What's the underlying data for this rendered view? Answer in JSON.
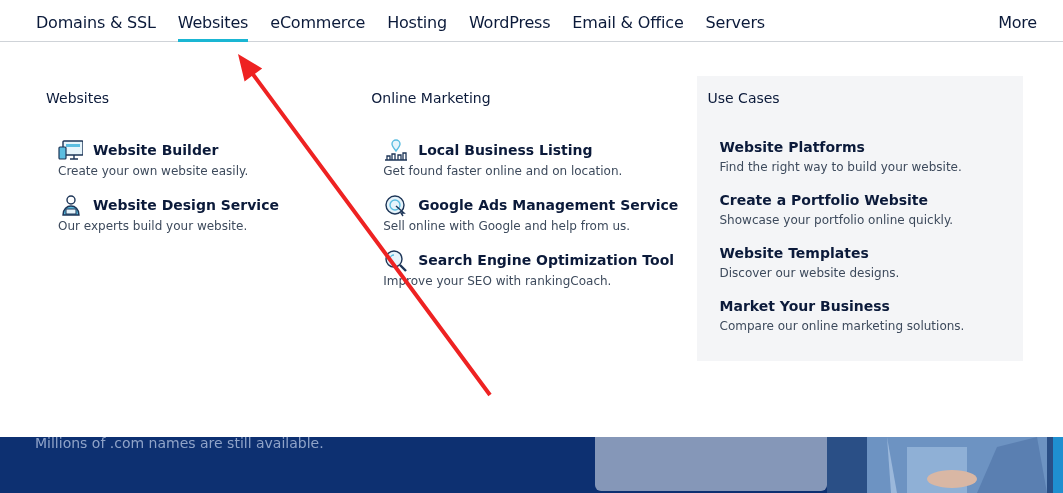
{
  "nav": {
    "items": [
      {
        "label": "Domains & SSL",
        "selected": false
      },
      {
        "label": "Websites",
        "selected": true
      },
      {
        "label": "eCommerce",
        "selected": false
      },
      {
        "label": "Hosting",
        "selected": false
      },
      {
        "label": "WordPress",
        "selected": false
      },
      {
        "label": "Email & Office",
        "selected": false
      },
      {
        "label": "Servers",
        "selected": false
      }
    ],
    "more": "More"
  },
  "menu": {
    "columns": [
      {
        "title": "Websites",
        "items": [
          {
            "title": "Website Builder",
            "description": "Create your own website easily."
          },
          {
            "title": "Website Design Service",
            "description": "Our experts build your website."
          }
        ]
      },
      {
        "title": "Online Marketing",
        "items": [
          {
            "title": "Local Business Listing",
            "description": "Get found faster online and on location."
          },
          {
            "title": "Google Ads Management Service",
            "description": "Sell online with Google and help from us."
          },
          {
            "title": "Search Engine Optimization Tool",
            "description": "Improve your SEO with rankingCoach."
          }
        ]
      }
    ],
    "use_cases": {
      "title": "Use Cases",
      "items": [
        {
          "title": "Website Platforms",
          "description": "Find the right way to build your website."
        },
        {
          "title": "Create a Portfolio Website",
          "description": "Showcase your portfolio online quickly."
        },
        {
          "title": "Website Templates",
          "description": "Discover our website designs."
        },
        {
          "title": "Market Your Business",
          "description": "Compare our online marketing solutions."
        }
      ]
    }
  },
  "banner": {
    "text": "Millions of .com names are still available."
  }
}
